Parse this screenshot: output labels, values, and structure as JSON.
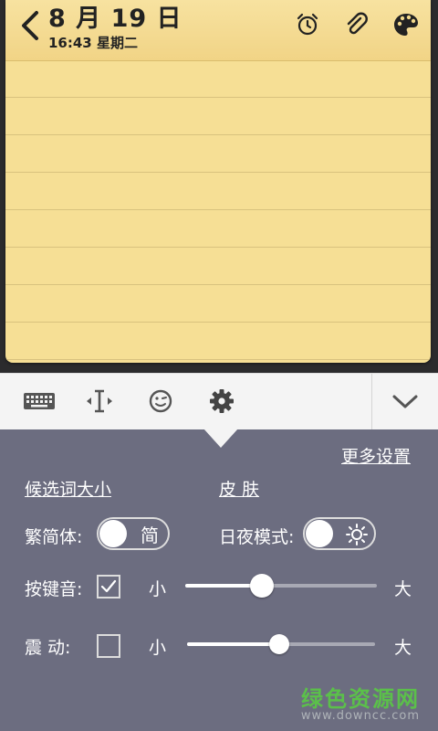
{
  "header": {
    "date": "8 月 19 日",
    "time": "16:43 星期二"
  },
  "icons": {
    "back": "chevron-left-icon",
    "alarm": "alarm-clock-icon",
    "attach": "paperclip-icon",
    "palette": "palette-icon"
  },
  "toolbar": {
    "items": [
      "keyboard-icon",
      "text-cursor-icon",
      "emoji-icon",
      "gear-icon",
      "chevron-down-icon"
    ]
  },
  "settings": {
    "more_link": "更多设置",
    "candidate_size": "候选词大小",
    "skin": "皮 肤",
    "trad_simp_label": "繁简体:",
    "trad_simp_value": "简",
    "day_night_label": "日夜模式:",
    "key_sound_label": "按键音:",
    "key_sound_checked": true,
    "vibrate_label": "震 动:",
    "vibrate_checked": false,
    "small": "小",
    "large": "大",
    "key_sound_level": 0.4,
    "vibrate_level": 0.49
  },
  "watermark": {
    "title": "绿色资源网",
    "url": "www.downcc.com"
  },
  "colors": {
    "note": "#f6df95",
    "panel": "#6c6d80",
    "toolbar": "#f4f4f4"
  }
}
